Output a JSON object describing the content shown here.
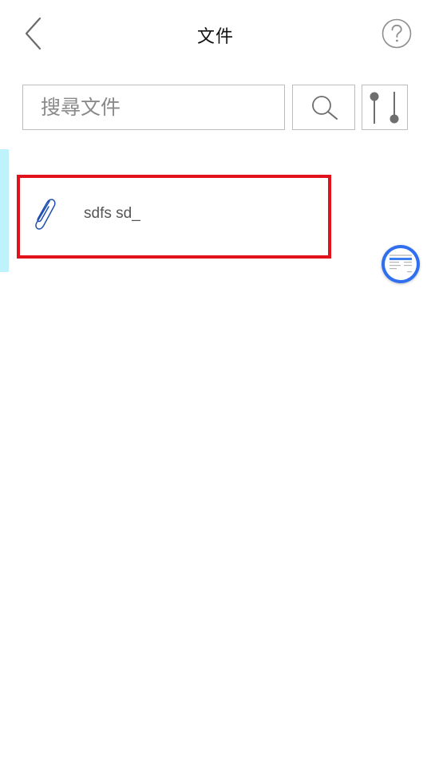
{
  "header": {
    "title": "文件",
    "back_icon": "chevron-left-icon",
    "help_icon": "question-circle-icon"
  },
  "search": {
    "placeholder": "搜尋文件",
    "search_icon": "search-icon",
    "filter_icon": "slider-filter-icon"
  },
  "files": [
    {
      "name": "sdfs sd_",
      "icon": "paperclip-icon"
    }
  ],
  "colors": {
    "highlight_border": "#e1121c",
    "side_accent": "#bff3fb",
    "float_ball": "#2f6ff0",
    "clip_icon": "#1f4fb0"
  }
}
